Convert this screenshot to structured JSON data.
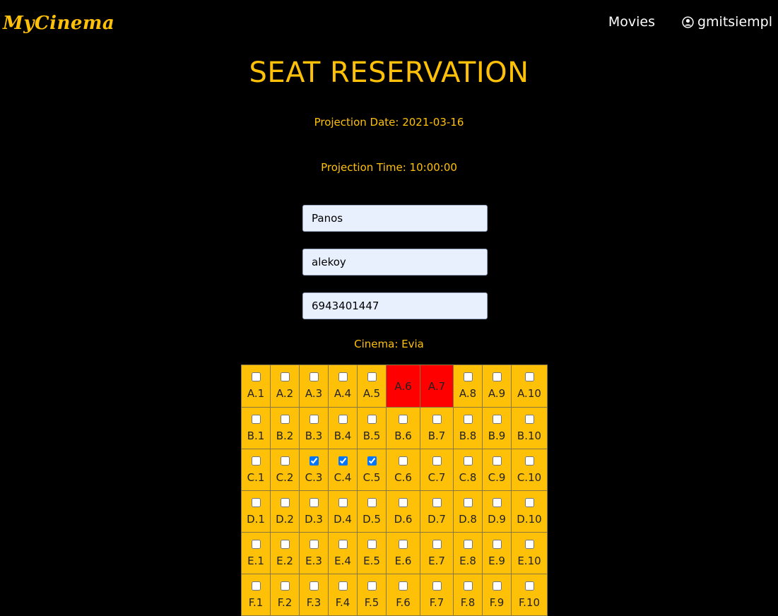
{
  "brand": "MyCinema",
  "nav": {
    "movies": "Movies",
    "user": "gmitsiempl"
  },
  "page_title": "SEAT RESERVATION",
  "projection_date": "Projection Date: 2021-03-16",
  "projection_time": "Projection Time: 10:00:00",
  "form": {
    "name": "Panos",
    "surname": "alekoy",
    "phone": "6943401447"
  },
  "cinema": "Cinema: Evia",
  "seat_grid": {
    "rows": [
      "A",
      "B",
      "C",
      "D",
      "E",
      "F"
    ],
    "cols": 10,
    "reserved": [
      "A.6",
      "A.7"
    ],
    "checked": [
      "C.3",
      "C.4",
      "C.5"
    ]
  },
  "colors": {
    "accent": "#ffc107",
    "reserved": "#ff0000",
    "background": "#000000"
  }
}
